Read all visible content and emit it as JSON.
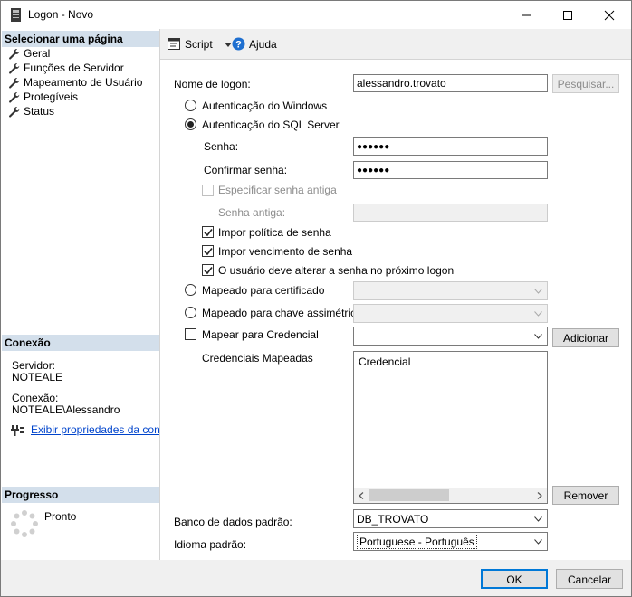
{
  "window": {
    "title": "Logon - Novo"
  },
  "sidebar": {
    "select_page_header": "Selecionar uma página",
    "pages": [
      {
        "label": "Geral",
        "icon": "wrench-icon"
      },
      {
        "label": "Funções de Servidor",
        "icon": "wrench-icon"
      },
      {
        "label": "Mapeamento de Usuário",
        "icon": "wrench-icon"
      },
      {
        "label": "Protegíveis",
        "icon": "wrench-icon"
      },
      {
        "label": "Status",
        "icon": "wrench-icon"
      }
    ],
    "connection_header": "Conexão",
    "server_label": "Servidor:",
    "server_value": "NOTEALE",
    "connection_label": "Conexão:",
    "connection_value": "NOTEALE\\Alessandro",
    "properties_link": "Exibir propriedades da conexã",
    "progress_header": "Progresso",
    "progress_status": "Pronto"
  },
  "toolbar": {
    "script_label": "Script",
    "help_label": "Ajuda"
  },
  "form": {
    "login_name_label": "Nome de logon:",
    "login_name_value": "alessandro.trovato",
    "search_button": "Pesquisar...",
    "windows_auth_label": "Autenticação do Windows",
    "sql_auth_label": "Autenticação do SQL Server",
    "password_label": "Senha:",
    "password_value": "●●●●●●",
    "confirm_password_label": "Confirmar senha:",
    "confirm_password_value": "●●●●●●",
    "specify_old_password_label": "Especificar senha antiga",
    "old_password_label": "Senha antiga:",
    "enforce_policy_label": "Impor política de senha",
    "enforce_expiration_label": "Impor vencimento de senha",
    "must_change_label": "O usuário deve alterar a senha no próximo logon",
    "certificate_label": "Mapeado para certificado",
    "asymmetric_key_label": "Mapeado para chave assimétrica",
    "credential_label": "Mapear para Credencial",
    "add_button": "Adicionar",
    "mapped_credentials_label": "Credenciais Mapeadas",
    "credentials_column": "Credencial",
    "remove_button": "Remover",
    "default_db_label": "Banco de dados padrão:",
    "default_db_value": "DB_TROVATO",
    "default_language_label": "Idioma padrão:",
    "default_language_value": "Portuguese - Português"
  },
  "buttons": {
    "ok": "OK",
    "cancel": "Cancelar"
  },
  "colors": {
    "section_header_bg": "#d3dfeb",
    "accent": "#0078d7",
    "link": "#0044cc"
  }
}
